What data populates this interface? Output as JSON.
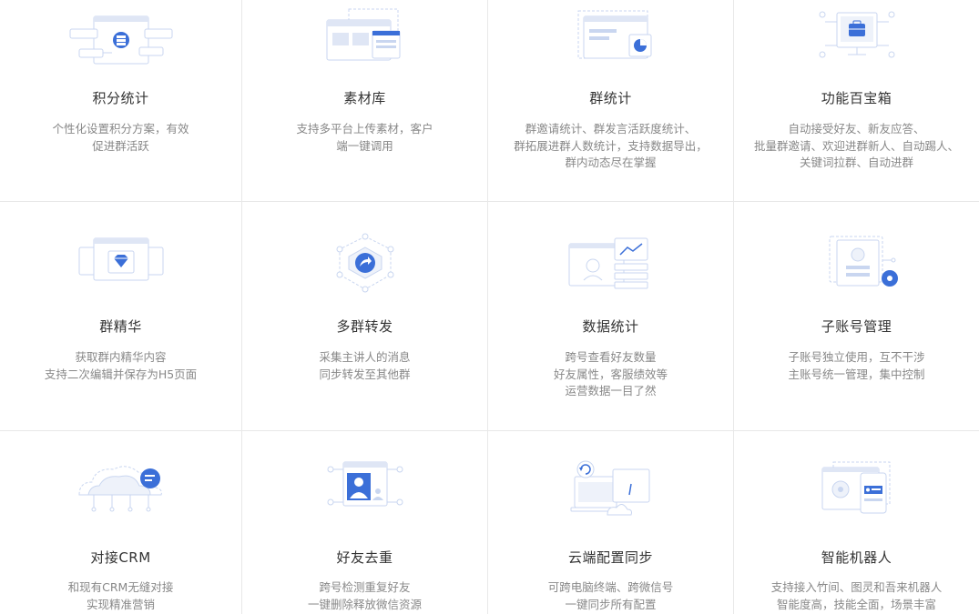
{
  "features": [
    {
      "title": "积分统计",
      "lines": [
        "个性化设置积分方案，有效",
        "促进群活跃"
      ],
      "icon": "points-stats-icon"
    },
    {
      "title": "素材库",
      "lines": [
        "支持多平台上传素材，客户",
        "端一键调用"
      ],
      "icon": "material-library-icon"
    },
    {
      "title": "群统计",
      "lines": [
        "群邀请统计、群发言活跃度统计、",
        "群拓展进群人数统计，支持数据导出，",
        "群内动态尽在掌握"
      ],
      "icon": "group-stats-icon"
    },
    {
      "title": "功能百宝箱",
      "lines": [
        "自动接受好友、新友应答、",
        "批量群邀请、欢迎进群新人、自动踢人、",
        "关键词拉群、自动进群"
      ],
      "icon": "toolbox-icon"
    },
    {
      "title": "群精华",
      "lines": [
        "获取群内精华内容",
        "支持二次编辑并保存为H5页面"
      ],
      "icon": "diamond-icon"
    },
    {
      "title": "多群转发",
      "lines": [
        "采集主讲人的消息",
        "同步转发至其他群"
      ],
      "icon": "forward-icon"
    },
    {
      "title": "数据统计",
      "lines": [
        "跨号查看好友数量",
        "好友属性，客服绩效等",
        "运营数据一目了然"
      ],
      "icon": "data-stats-icon"
    },
    {
      "title": "子账号管理",
      "lines": [
        "子账号独立使用，互不干涉",
        "主账号统一管理，集中控制"
      ],
      "icon": "sub-account-icon"
    },
    {
      "title": "对接CRM",
      "lines": [
        "和现有CRM无缝对接",
        "实现精准营销"
      ],
      "icon": "crm-cloud-icon"
    },
    {
      "title": "好友去重",
      "lines": [
        "跨号检测重复好友",
        "一键删除释放微信资源"
      ],
      "icon": "dedupe-user-icon"
    },
    {
      "title": "云端配置同步",
      "lines": [
        "可跨电脑终端、跨微信号",
        "一键同步所有配置"
      ],
      "icon": "cloud-sync-icon"
    },
    {
      "title": "智能机器人",
      "lines": [
        "支持接入竹间、图灵和吾来机器人",
        "智能度高，技能全面，场景丰富"
      ],
      "icon": "robot-icon"
    }
  ],
  "colors": {
    "accent": "#3b6fd8",
    "light": "#c9d6f0",
    "pale": "#eef2fa",
    "title": "#333333",
    "desc": "#888888"
  }
}
